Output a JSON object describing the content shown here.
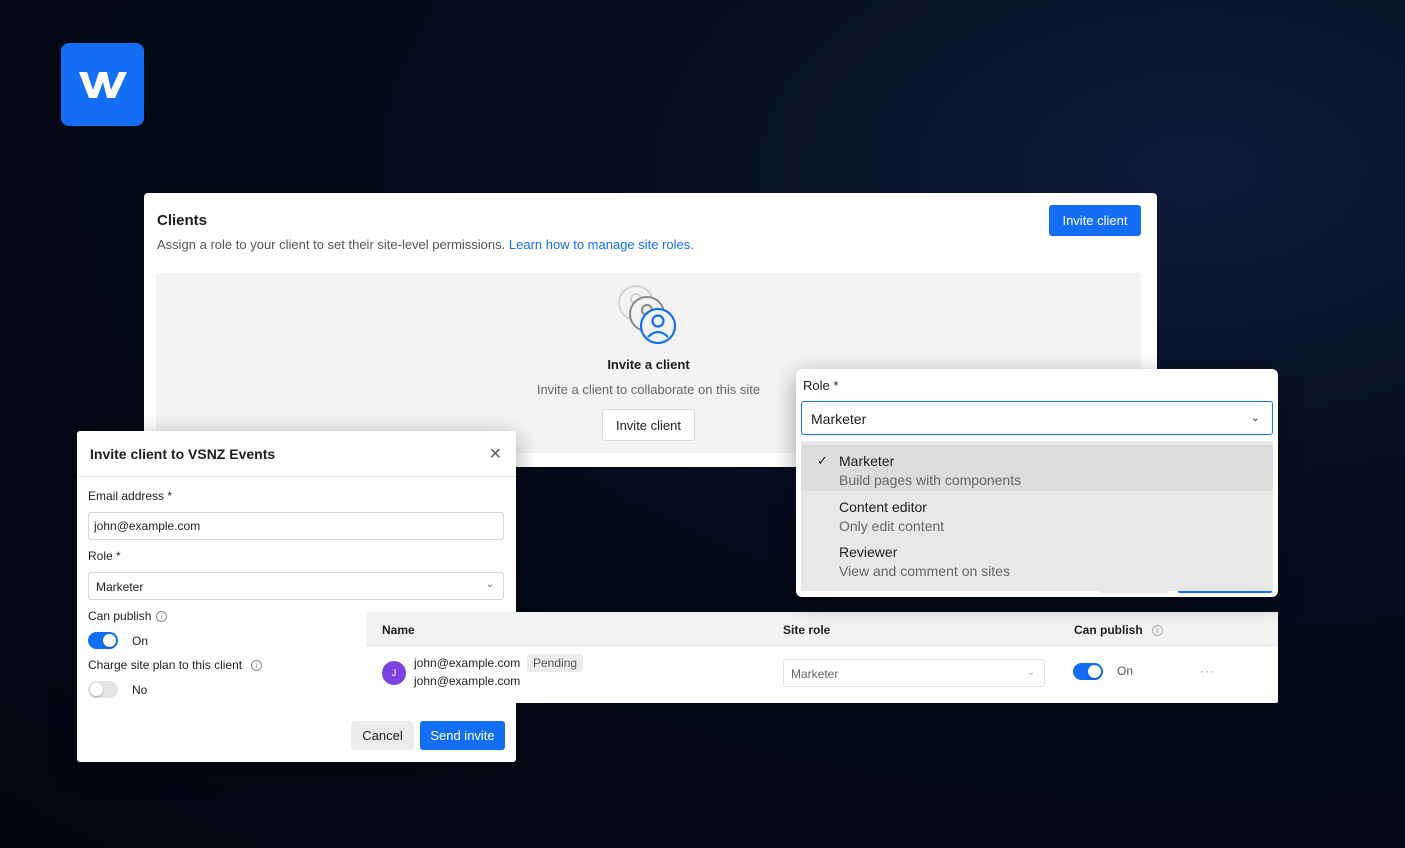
{
  "brand": {
    "logo_icon": "webflow-logo-icon",
    "color": "#146ef5"
  },
  "clients": {
    "title": "Clients",
    "subtitle": "Assign a role to your client to set their site-level permissions.",
    "learn_link": "Learn how to manage site roles.",
    "invite_button": "Invite client",
    "empty": {
      "icon": "users-icon",
      "title": "Invite a client",
      "subtitle": "Invite a client to collaborate on this site",
      "button": "Invite client"
    }
  },
  "modal": {
    "title": "Invite client to VSNZ Events",
    "close_icon": "close-icon",
    "email_label": "Email address *",
    "email_value": "john@example.com",
    "role_label": "Role *",
    "role_value": "Marketer",
    "can_publish_label": "Can publish",
    "can_publish_state": "On",
    "charge_label": "Charge site plan to this client",
    "charge_state": "No",
    "cancel": "Cancel",
    "send": "Send invite"
  },
  "table": {
    "headers": {
      "name": "Name",
      "site_role": "Site role",
      "can_publish": "Can publish"
    },
    "row": {
      "avatar_initial": "J",
      "email": "john@example.com",
      "email_secondary": "john@example.com",
      "status": "Pending",
      "role": "Marketer",
      "publish": "On",
      "more": "···"
    }
  },
  "role_popover": {
    "label": "Role *",
    "selected": "Marketer",
    "options": [
      {
        "title": "Marketer",
        "desc": "Build pages with components",
        "checked": true
      },
      {
        "title": "Content editor",
        "desc": "Only edit content",
        "checked": false
      },
      {
        "title": "Reviewer",
        "desc": "View and comment on sites",
        "checked": false
      }
    ]
  }
}
